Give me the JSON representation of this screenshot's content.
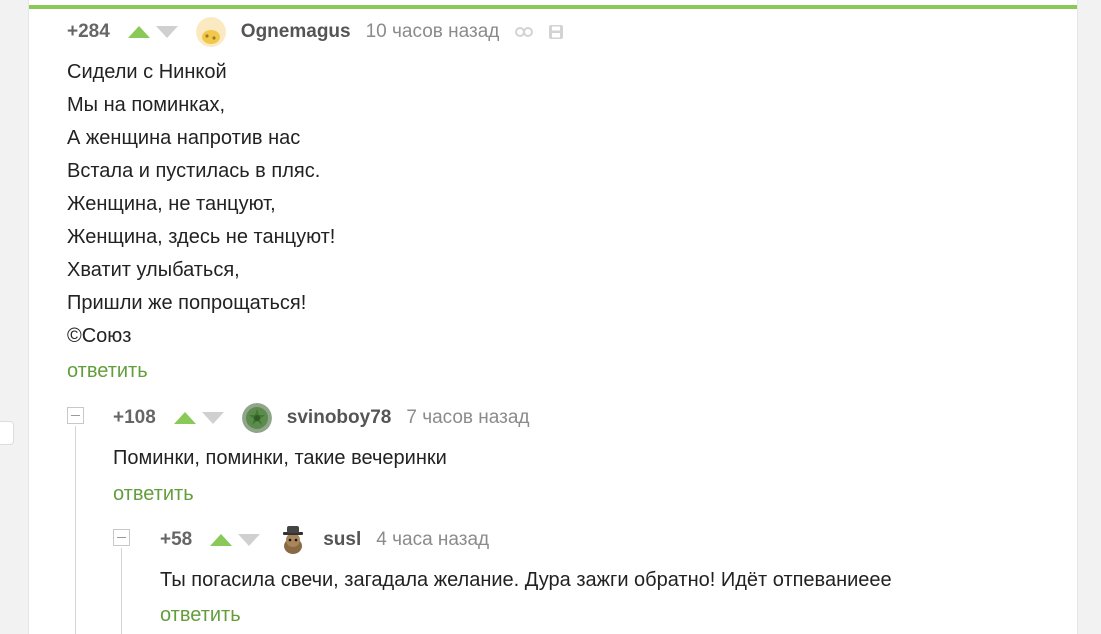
{
  "comments": [
    {
      "rating": "+284",
      "username": "Ognemagus",
      "time": "10 часов назад",
      "lines": [
        "Сидели с Нинкой",
        "Мы на поминках,",
        "А женщина напротив нас",
        "Встала и пустилась в пляс.",
        "Женщина, не танцуют,",
        "Женщина, здесь не танцуют!",
        "Хватит улыбаться,",
        "Пришли же попрощаться!",
        "©Союз"
      ],
      "reply_label": "ответить"
    },
    {
      "rating": "+108",
      "username": "svinoboy78",
      "time": "7 часов назад",
      "lines": [
        "Поминки, поминки, такие вечеринки"
      ],
      "reply_label": "ответить"
    },
    {
      "rating": "+58",
      "username": "susl",
      "time": "4 часа назад",
      "lines": [
        "Ты погасила свечи, загадала желание. Дура зажги обратно! Идёт отпеваниеее"
      ],
      "reply_label": "ответить"
    }
  ],
  "icons": {
    "upvote": "arrow-up-icon",
    "downvote": "arrow-down-icon",
    "link": "link-icon",
    "save": "save-icon",
    "collapse": "collapse-icon"
  },
  "colors": {
    "accent_green": "#8ac858",
    "reply_green": "#649e3c",
    "vote_inactive": "#d0d0d0"
  }
}
